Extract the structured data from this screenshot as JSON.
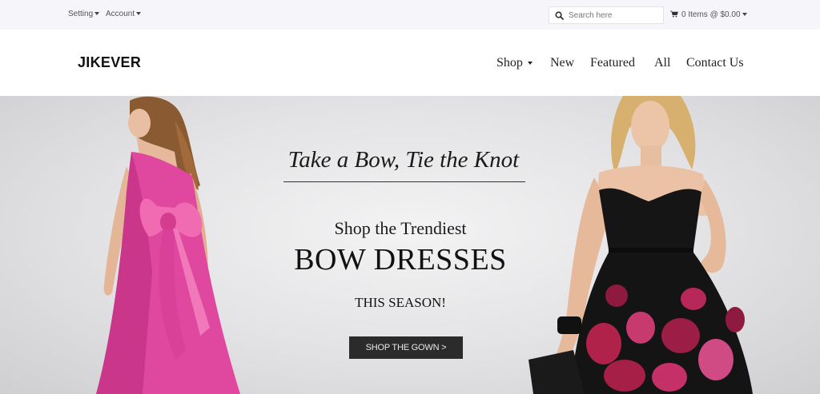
{
  "topbar": {
    "setting_label": "Setting",
    "account_label": "Account",
    "search_placeholder": "Search here",
    "cart_text": "0 Items @ $0.00"
  },
  "header": {
    "logo": "JIKEVER",
    "nav": [
      {
        "label": "Shop",
        "has_dropdown": true
      },
      {
        "label": "New"
      },
      {
        "label": "Featured"
      },
      {
        "label": "All"
      },
      {
        "label": "Contact Us"
      }
    ]
  },
  "hero": {
    "tagline": "Take a Bow, Tie the Knot",
    "subhead": "Shop the Trendiest",
    "headline": "BOW DRESSES",
    "season": "THIS SEASON!",
    "cta_label": "SHOP THE GOWN >"
  },
  "colors": {
    "topbar_bg": "#f5f5fa",
    "pink_gown": "#e0489f",
    "black_dress": "#151515",
    "floral_red": "#b0224a",
    "cta_bg": "#2b2b2b"
  }
}
